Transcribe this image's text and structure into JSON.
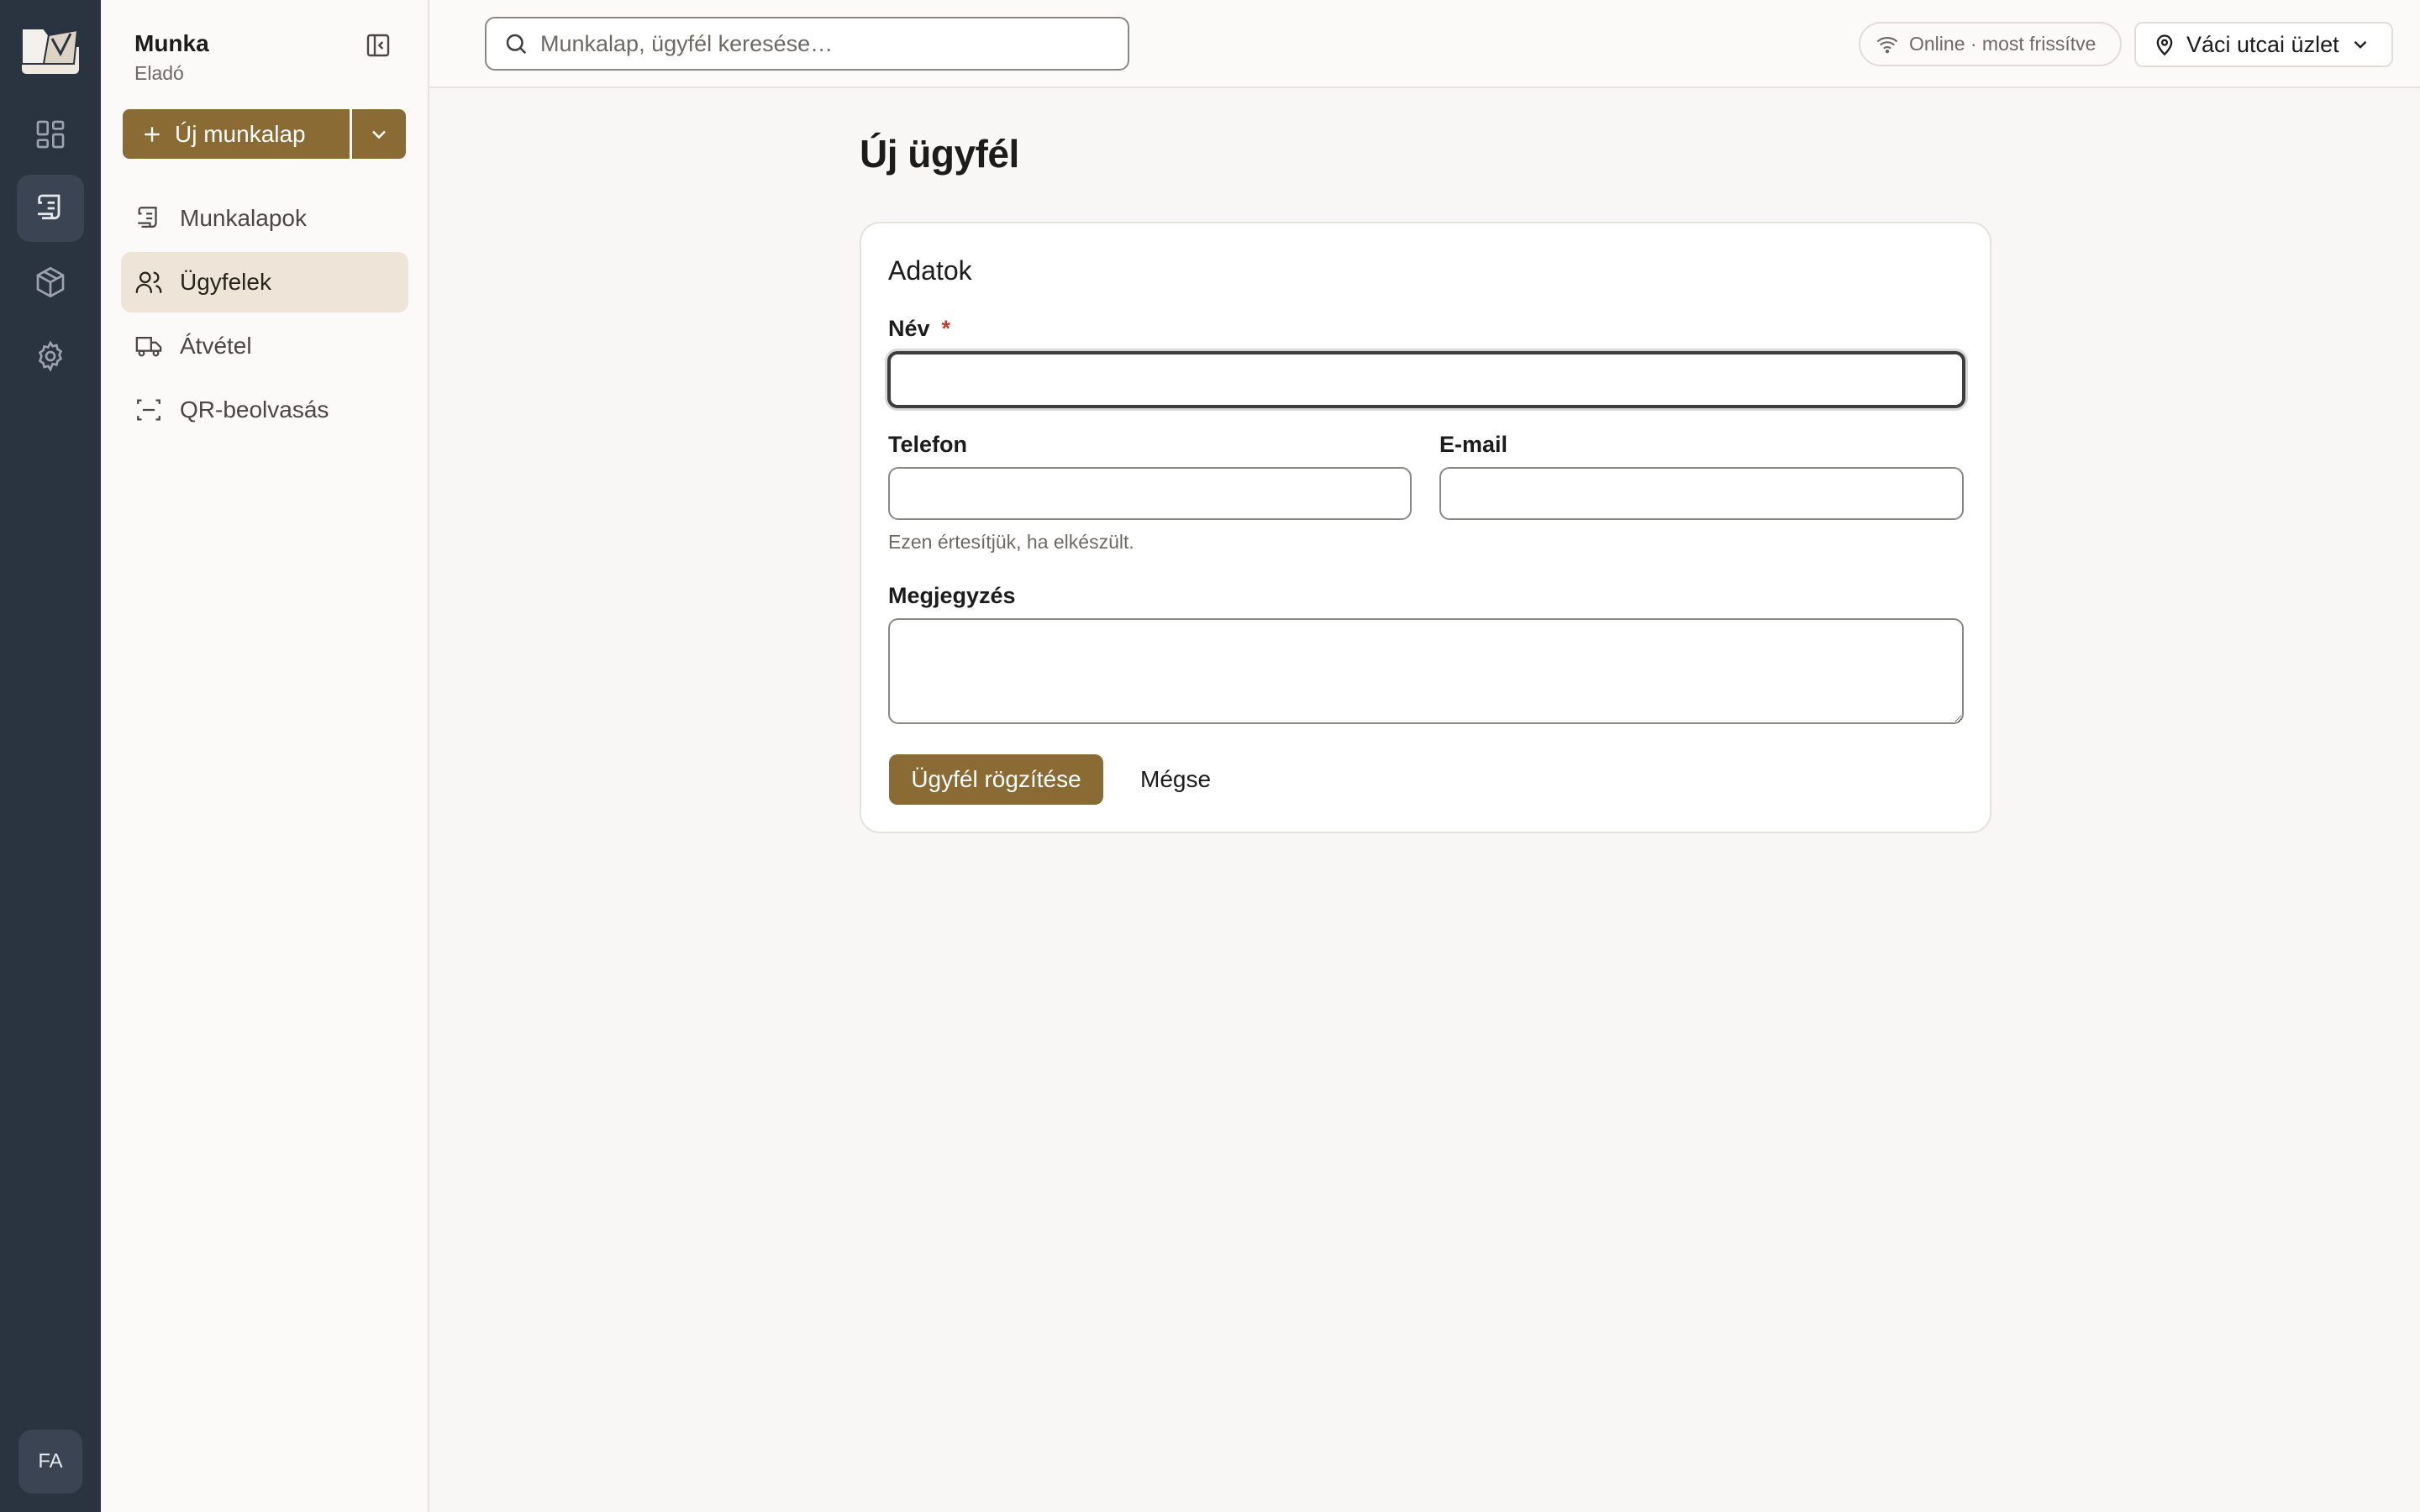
{
  "rail": {
    "items": [
      {
        "icon": "dashboard-icon"
      },
      {
        "icon": "worksheet-icon",
        "active": true
      },
      {
        "icon": "package-icon"
      },
      {
        "icon": "settings-icon"
      }
    ],
    "avatar": "FA"
  },
  "sidebar": {
    "title": "Munka",
    "subtitle": "Eladó",
    "new_button": "Új munkalap",
    "items": [
      {
        "label": "Munkalapok",
        "icon": "worksheet-icon"
      },
      {
        "label": "Ügyfelek",
        "icon": "users-icon",
        "active": true
      },
      {
        "label": "Átvétel",
        "icon": "truck-icon"
      },
      {
        "label": "QR-beolvasás",
        "icon": "qr-scan-icon"
      }
    ]
  },
  "topbar": {
    "search_placeholder": "Munkalap, ügyfél keresése…",
    "status": "Online · most frissítve",
    "store": "Váci utcai üzlet"
  },
  "page": {
    "title": "Új ügyfél"
  },
  "form": {
    "section_title": "Adatok",
    "name_label": "Név",
    "required_mark": "*",
    "name_value": "",
    "phone_label": "Telefon",
    "phone_value": "",
    "phone_hint": "Ezen értesítjük, ha elkészült.",
    "email_label": "E-mail",
    "email_value": "",
    "note_label": "Megjegyzés",
    "note_value": "",
    "submit": "Ügyfél rögzítése",
    "cancel": "Mégse"
  },
  "colors": {
    "accent": "#8a6b34",
    "rail": "#2a3340",
    "active_nav": "#eee5d8"
  }
}
